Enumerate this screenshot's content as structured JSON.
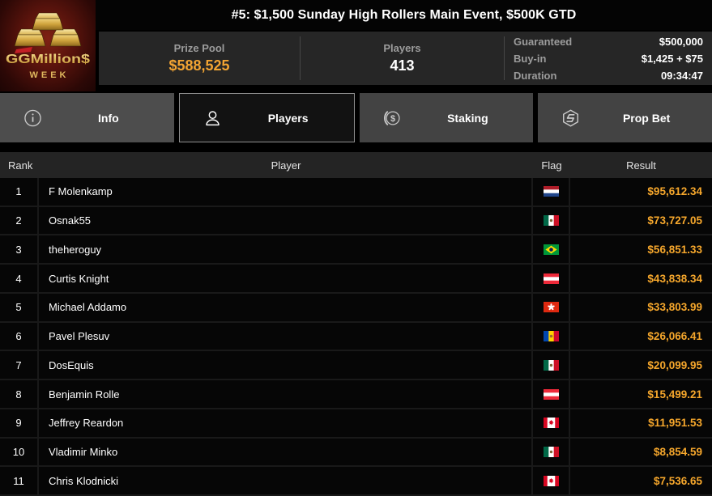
{
  "colors": {
    "gold": "#f2a433",
    "result_gold": "#f6a72c",
    "active_tab_border": "#8f8f8f"
  },
  "header": {
    "title": "#5: $1,500 Sunday High Rollers Main Event, $500K GTD",
    "logo": {
      "brand": "GGMillion$",
      "subtitle": "W E E K"
    },
    "prize_pool": {
      "label": "Prize Pool",
      "value": "$588,525"
    },
    "players": {
      "label": "Players",
      "value": "413"
    },
    "details": [
      {
        "label": "Guaranteed",
        "value": "$500,000"
      },
      {
        "label": "Buy-in",
        "value": "$1,425 + $75"
      },
      {
        "label": "Duration",
        "value": "09:34:47"
      }
    ]
  },
  "tabs": [
    {
      "label": "Info",
      "icon": "info-icon",
      "active": false
    },
    {
      "label": "Players",
      "icon": "players-icon",
      "active": true
    },
    {
      "label": "Staking",
      "icon": "staking-icon",
      "active": false
    },
    {
      "label": "Prop Bet",
      "icon": "prop-bet-icon",
      "active": false
    }
  ],
  "table": {
    "columns": [
      "Rank",
      "Player",
      "Flag",
      "Result"
    ],
    "rows": [
      {
        "rank": "1",
        "player": "F Molenkamp",
        "flag": "nl",
        "flag_name": "netherlands",
        "result": "$95,612.34"
      },
      {
        "rank": "2",
        "player": "Osnak55",
        "flag": "mx",
        "flag_name": "mexico",
        "result": "$73,727.05"
      },
      {
        "rank": "3",
        "player": "theheroguy",
        "flag": "br",
        "flag_name": "brazil",
        "result": "$56,851.33"
      },
      {
        "rank": "4",
        "player": "Curtis Knight",
        "flag": "at",
        "flag_name": "austria",
        "result": "$43,838.34"
      },
      {
        "rank": "5",
        "player": "Michael Addamo",
        "flag": "hk",
        "flag_name": "hong-kong",
        "result": "$33,803.99"
      },
      {
        "rank": "6",
        "player": "Pavel Plesuv",
        "flag": "md",
        "flag_name": "moldova",
        "result": "$26,066.41"
      },
      {
        "rank": "7",
        "player": "DosEquis",
        "flag": "mx",
        "flag_name": "mexico",
        "result": "$20,099.95"
      },
      {
        "rank": "8",
        "player": "Benjamin Rolle",
        "flag": "at",
        "flag_name": "austria",
        "result": "$15,499.21"
      },
      {
        "rank": "9",
        "player": "Jeffrey Reardon",
        "flag": "ca",
        "flag_name": "canada",
        "result": "$11,951.53"
      },
      {
        "rank": "10",
        "player": "Vladimir Minko",
        "flag": "mx",
        "flag_name": "mexico",
        "result": "$8,854.59"
      },
      {
        "rank": "11",
        "player": "Chris Klodnicki",
        "flag": "ca",
        "flag_name": "canada",
        "result": "$7,536.65"
      }
    ]
  }
}
